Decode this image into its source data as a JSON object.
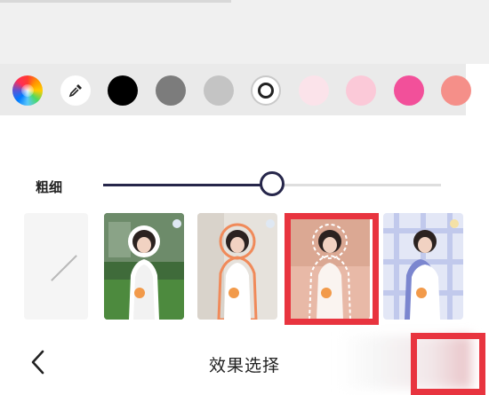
{
  "palette": {
    "swatches": [
      {
        "name": "color-wheel-icon",
        "kind": "wheel"
      },
      {
        "name": "eyedropper-icon",
        "kind": "picker"
      },
      {
        "name": "swatch-black",
        "kind": "solid",
        "color": "#000000"
      },
      {
        "name": "swatch-dark-gray",
        "kind": "solid",
        "color": "#7c7c7c"
      },
      {
        "name": "swatch-light-gray",
        "kind": "solid",
        "color": "#c4c4c4"
      },
      {
        "name": "swatch-white-selected",
        "kind": "selected"
      },
      {
        "name": "swatch-pale-pink",
        "kind": "solid",
        "color": "#fbe3ea"
      },
      {
        "name": "swatch-light-pink",
        "kind": "solid",
        "color": "#fbc9d8"
      },
      {
        "name": "swatch-hot-pink",
        "kind": "solid",
        "color": "#f2509a"
      },
      {
        "name": "swatch-coral",
        "kind": "solid",
        "color": "#f58f89"
      }
    ]
  },
  "thickness": {
    "label": "粗细",
    "value_fraction": 0.5
  },
  "effects": {
    "items": [
      {
        "name": "effect-none",
        "style": "none"
      },
      {
        "name": "effect-garden-white-outline",
        "style": "garden"
      },
      {
        "name": "effect-orange-outline",
        "style": "orange"
      },
      {
        "name": "effect-dashed-outline",
        "style": "dashed",
        "selected": true
      },
      {
        "name": "effect-plaid-shadow",
        "style": "plaid"
      }
    ]
  },
  "bottom_bar": {
    "title": "效果选择",
    "back_icon": "chevron-left-icon"
  },
  "accent_colors": {
    "highlight": "#e8343f",
    "slider": "#26264a"
  }
}
